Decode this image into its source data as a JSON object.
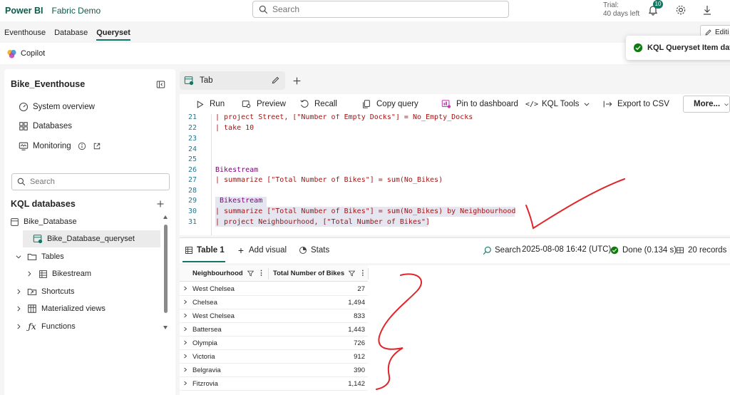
{
  "topbar": {
    "brand": "Power BI",
    "workspace": "Fabric Demo",
    "search_placeholder": "Search",
    "trial_line1": "Trial:",
    "trial_line2": "40 days left",
    "notification_count": "10"
  },
  "nav": {
    "tabs": [
      "Eventhouse",
      "Database",
      "Queryset"
    ],
    "edit_label": "Editi"
  },
  "copilot": {
    "label": "Copilot"
  },
  "toast": {
    "message": "KQL Queryset Item data"
  },
  "sidebar": {
    "title": "Bike_Eventhouse",
    "items": [
      "System overview",
      "Databases",
      "Monitoring"
    ],
    "search_placeholder": "Search",
    "kql_title": "KQL databases",
    "tree": {
      "database": "Bike_Database",
      "queryset": "Bike_Database_queryset",
      "tables": "Tables",
      "table": "Bikestream",
      "shortcuts": "Shortcuts",
      "materialized": "Materialized views",
      "functions": "Functions"
    }
  },
  "query_tab": {
    "label": "Tab"
  },
  "toolbar": {
    "run": "Run",
    "preview": "Preview",
    "recall": "Recall",
    "copy": "Copy query",
    "pin": "Pin to dashboard",
    "kql_tools": "KQL Tools",
    "export": "Export to CSV",
    "more": "More..."
  },
  "editor": {
    "lines": [
      {
        "n": "21",
        "text": "| project Street, [\"Number of Empty Docks\"] = No_Empty_Docks"
      },
      {
        "n": "22",
        "text": "| take 10"
      },
      {
        "n": "23",
        "text": ""
      },
      {
        "n": "24",
        "text": ""
      },
      {
        "n": "25",
        "text": ""
      },
      {
        "n": "26",
        "text": "Bikestream"
      },
      {
        "n": "27",
        "text": "| summarize [\"Total Number of Bikes\"] = sum(No_Bikes)"
      },
      {
        "n": "28",
        "text": ""
      },
      {
        "n": "29",
        "text": " Bikestream"
      },
      {
        "n": "30",
        "text": "| summarize [\"Total Number of Bikes\"] = sum(No_Bikes) by Neighbourhood"
      },
      {
        "n": "31",
        "text": "| project Neighbourhood, [\"Total Number of Bikes\"]"
      }
    ]
  },
  "results": {
    "table_tab": "Table 1",
    "add_visual": "Add visual",
    "stats": "Stats",
    "search": "Search",
    "timestamp": "2025-08-08 16:42 (UTC)",
    "status": "Done (0.134 s)",
    "records": "20 records",
    "columns": [
      "Neighbourhood",
      "Total Number of Bikes"
    ],
    "rows": [
      [
        "West Chelsea",
        "27"
      ],
      [
        "Chelsea",
        "1,494"
      ],
      [
        "West Chelsea",
        "833"
      ],
      [
        "Battersea",
        "1,443"
      ],
      [
        "Olympia",
        "726"
      ],
      [
        "Victoria",
        "912"
      ],
      [
        "Belgravia",
        "390"
      ],
      [
        "Fitzrovia",
        "1,142"
      ]
    ]
  },
  "colors": {
    "accent": "#117865",
    "annotation": "#e0252b",
    "success": "#107c10"
  },
  "icons": [
    "search-icon",
    "bell-icon",
    "gear-icon",
    "download-icon",
    "copilot-icon",
    "check-circle-icon",
    "gauge-icon",
    "database-icon",
    "monitor-icon",
    "info-icon",
    "external-link-icon",
    "plus-icon",
    "table-icon",
    "chevron-right-icon",
    "chevron-down-icon",
    "pencil-icon",
    "play-icon",
    "preview-icon",
    "recall-icon",
    "copy-icon",
    "pin-icon",
    "code-icon",
    "export-icon",
    "filter-icon",
    "more-vertical-icon"
  ]
}
